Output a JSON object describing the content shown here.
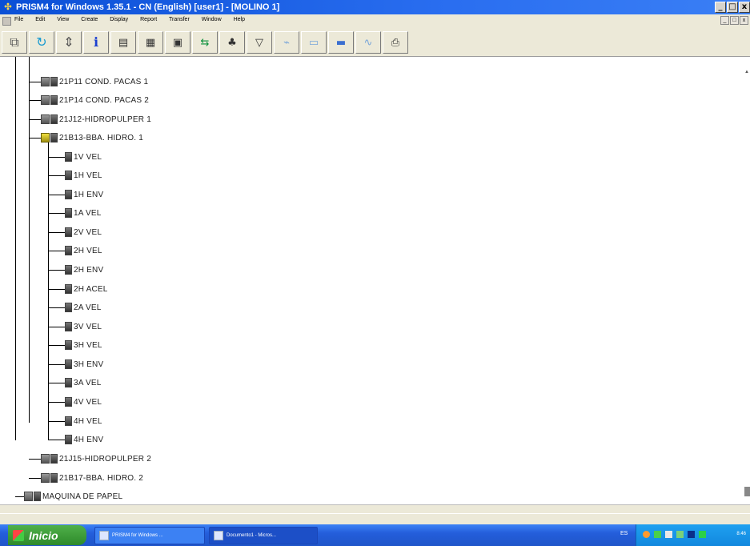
{
  "window": {
    "title": "PRISM4 for Windows 1.35.1 - CN (English) [user1] - [MOLINO 1]",
    "buttons": [
      "_",
      "□",
      "x"
    ]
  },
  "menu": {
    "items": [
      "File",
      "Edit",
      "View",
      "Create",
      "Display",
      "Report",
      "Transfer",
      "Window",
      "Help"
    ],
    "mdi_buttons": [
      "_",
      "□",
      "x"
    ]
  },
  "toolbar": {
    "icons": [
      "network-icon",
      "refresh-icon",
      "pointer-icon",
      "info-icon",
      "grid-icon-1",
      "grid-icon-2",
      "grid-icon-3",
      "route-icon",
      "tree-icon",
      "filter-icon",
      "chart-icon-1",
      "chart-icon-2",
      "chart-icon-3",
      "chart-icon-4",
      "print-icon"
    ]
  },
  "tree": {
    "nodes": [
      {
        "label": "21P11 COND. PACAS 1"
      },
      {
        "label": "21P14 COND. PACAS 2"
      },
      {
        "label": "21J12-HIDROPULPER 1"
      },
      {
        "label": "21B13-BBA. HIDRO. 1"
      },
      {
        "label": "1V VEL"
      },
      {
        "label": "1H VEL"
      },
      {
        "label": "1H ENV"
      },
      {
        "label": "1A VEL"
      },
      {
        "label": "2V VEL"
      },
      {
        "label": "2H VEL"
      },
      {
        "label": "2H ENV"
      },
      {
        "label": "2H ACEL"
      },
      {
        "label": "2A VEL"
      },
      {
        "label": "3V VEL"
      },
      {
        "label": "3H VEL"
      },
      {
        "label": "3H ENV"
      },
      {
        "label": "3A VEL"
      },
      {
        "label": "4V VEL"
      },
      {
        "label": "4H VEL"
      },
      {
        "label": "4H ENV"
      },
      {
        "label": "21J15-HIDROPULPER 2"
      },
      {
        "label": "21B17-BBA. HIDRO. 2"
      },
      {
        "label": "MAQUINA DE PAPEL"
      }
    ]
  },
  "taskbar": {
    "start_label": "Inicio",
    "tasks": [
      {
        "label": "PRISM4 for Windows ..."
      },
      {
        "label": "Documento1 - Micros..."
      }
    ],
    "tray_lang": "ES",
    "clock": "8:46"
  }
}
